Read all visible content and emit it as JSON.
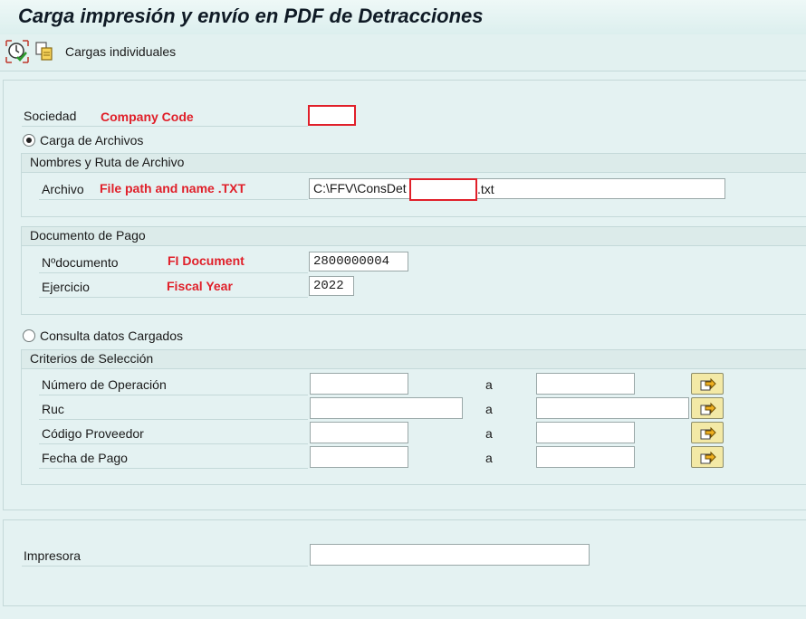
{
  "title": "Carga impresión y envío en PDF de Detracciones",
  "toolbar": {
    "execute_icon": "execute-clock-check-icon",
    "copy_icon": "copy-variant-icon",
    "label": "Cargas individuales"
  },
  "sociedad": {
    "label": "Sociedad",
    "annotation": "Company Code",
    "value": ""
  },
  "carga": {
    "radio_label": "Carga de Archivos",
    "selected": true,
    "group_title": "Nombres y Ruta de Archivo",
    "archivo_label": "Archivo",
    "archivo_annotation": "File path and name .TXT",
    "archivo_prefix": "C:\\FFV\\ConsDet",
    "archivo_suffix": ".txt"
  },
  "documento": {
    "group_title": "Documento de Pago",
    "ndoc_label": "Nºdocumento",
    "ndoc_annotation": "FI Document",
    "ndoc_value": "2800000004",
    "ejercicio_label": "Ejercicio",
    "ejercicio_annotation": "Fiscal Year",
    "ejercicio_value": "2022"
  },
  "consulta": {
    "radio_label": "Consulta datos Cargados",
    "selected": false,
    "group_title": "Criterios de Selección",
    "to_label": "a",
    "rows": [
      {
        "label": "Número de Operación",
        "from": "",
        "to": ""
      },
      {
        "label": "Ruc",
        "from": "",
        "to": ""
      },
      {
        "label": "Código Proveedor",
        "from": "",
        "to": ""
      },
      {
        "label": "Fecha de Pago",
        "from": "",
        "to": ""
      }
    ]
  },
  "impresora": {
    "label": "Impresora",
    "value": ""
  },
  "colors": {
    "background": "#e4f2f2",
    "annotation_red": "#e0202a",
    "select_button": "#f3e9a6"
  }
}
